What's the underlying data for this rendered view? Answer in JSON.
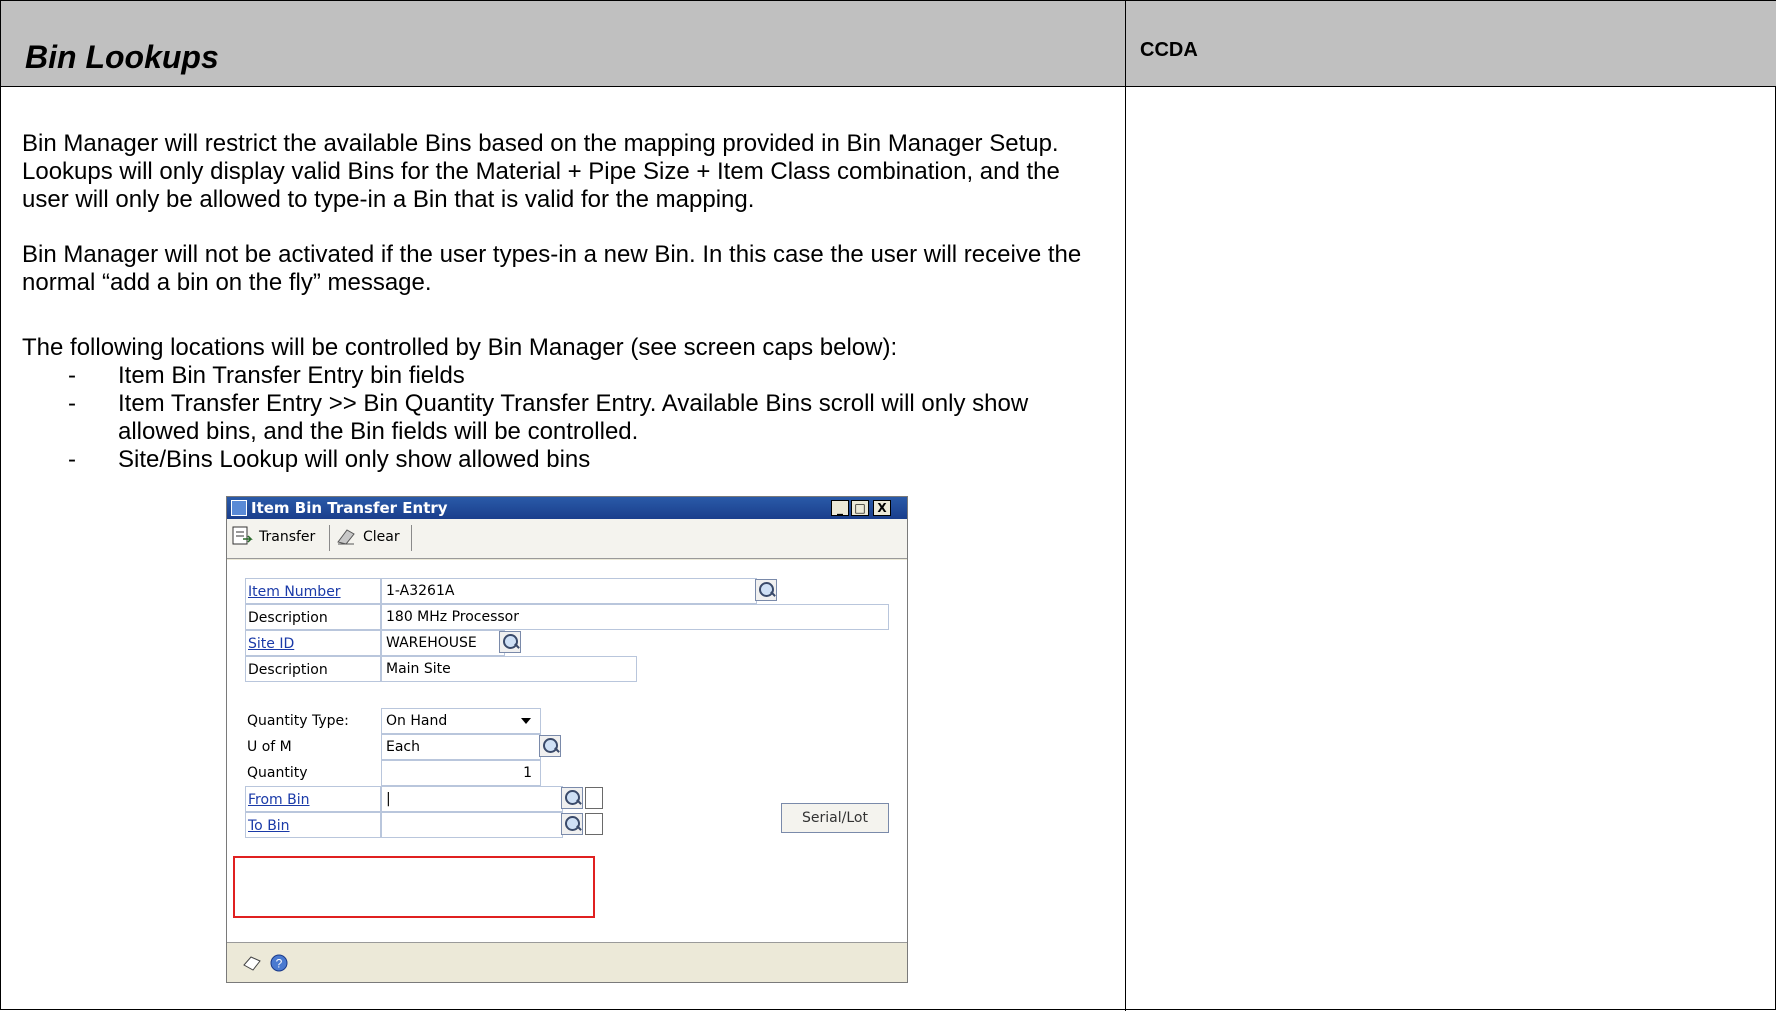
{
  "header": {
    "title": "Bin Lookups",
    "right_label": "CCDA"
  },
  "paragraphs": [
    "Bin Manager will restrict the available Bins based on the mapping provided in Bin Manager Setup.  Lookups will only display valid Bins for the Material + Pipe Size + Item Class combination, and the user will only be allowed to type-in a Bin that is valid for the mapping.",
    "Bin Manager will not be activated if the user types-in a new Bin.  In this case the user will receive the normal “add a bin on the fly” message.",
    "The following locations will be controlled by Bin Manager (see screen caps below):"
  ],
  "bullets": [
    "Item Bin Transfer Entry bin fields",
    "Item Transfer Entry >> Bin Quantity Transfer Entry.  Available Bins scroll will only show allowed bins, and the Bin fields will be controlled.",
    "Site/Bins Lookup will only show allowed bins"
  ],
  "bullet_dash": "-",
  "dialog": {
    "title": "Item Bin Transfer Entry",
    "minimize": "_",
    "maximize": "□",
    "close": "X",
    "toolbar": {
      "transfer": "Transfer",
      "clear": "Clear"
    },
    "fields": {
      "item_number_label": "Item Number",
      "item_number_value": "1-A3261A",
      "description_label": "Description",
      "description_value": "180 MHz Processor",
      "site_id_label": "Site ID",
      "site_id_value": "WAREHOUSE",
      "site_desc_label": "Description",
      "site_desc_value": "Main Site",
      "quantity_type_label": "Quantity Type:",
      "quantity_type_value": "On Hand",
      "uofm_label": "U of M",
      "uofm_value": "Each",
      "quantity_label": "Quantity",
      "quantity_value": "1",
      "from_bin_label": "From Bin",
      "from_bin_value": "|",
      "to_bin_label": "To Bin",
      "to_bin_value": ""
    },
    "serial_lot": "Serial/Lot"
  },
  "colors": {
    "header_bg": "#c0c0c0",
    "highlight_box": "#e02020",
    "link": "#1a3aa8"
  }
}
